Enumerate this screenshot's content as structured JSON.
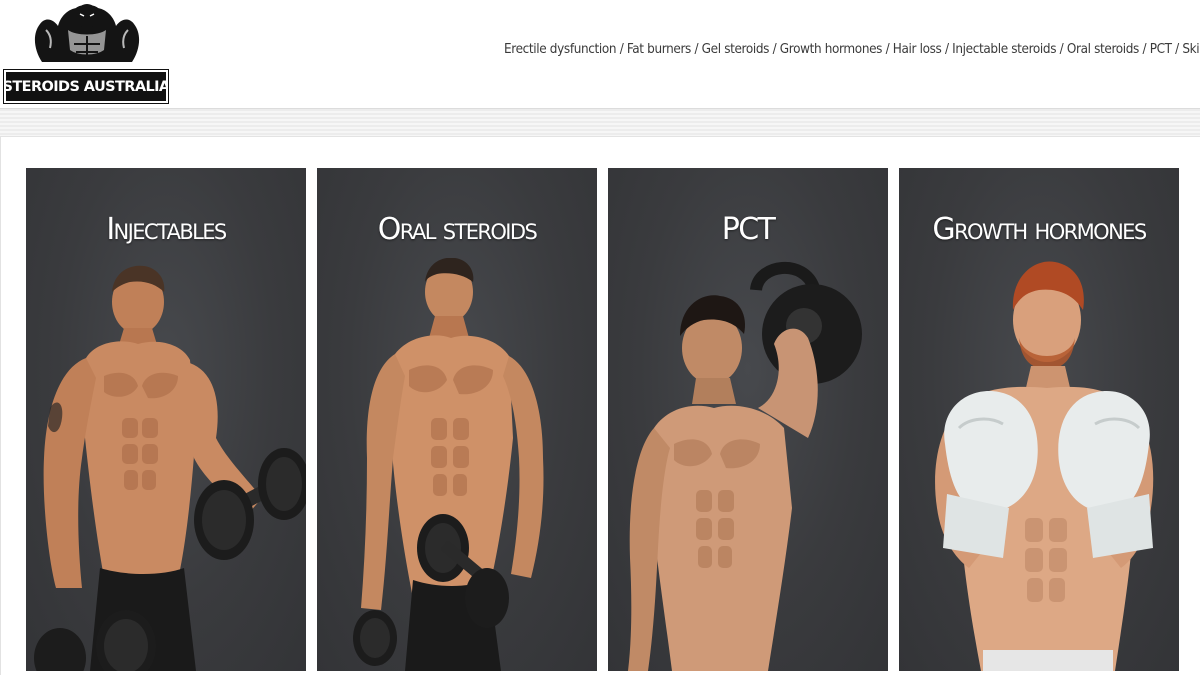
{
  "site": {
    "logo_text": "STEROIDS AUSTRALIA"
  },
  "nav": {
    "items": [
      "Erectile dysfunction",
      "Fat burners",
      "Gel steroids",
      "Growth hormones",
      "Hair loss",
      "Injectable steroids",
      "Oral steroids",
      "PCT",
      "Skin"
    ],
    "separator": "/"
  },
  "categories": [
    {
      "title": "Injectables",
      "icon": "bodybuilder-dumbbell-curl-photo"
    },
    {
      "title": "Oral steroids",
      "icon": "bodybuilder-dumbbell-photo"
    },
    {
      "title": "PCT",
      "icon": "man-kettlebell-photo"
    },
    {
      "title": "Growth hormones",
      "icon": "boxer-gloves-photo"
    }
  ],
  "colors": {
    "card_background": "#3a3b3e",
    "skin_tone": "#c98a62",
    "nav_text": "#3a3a3a"
  }
}
